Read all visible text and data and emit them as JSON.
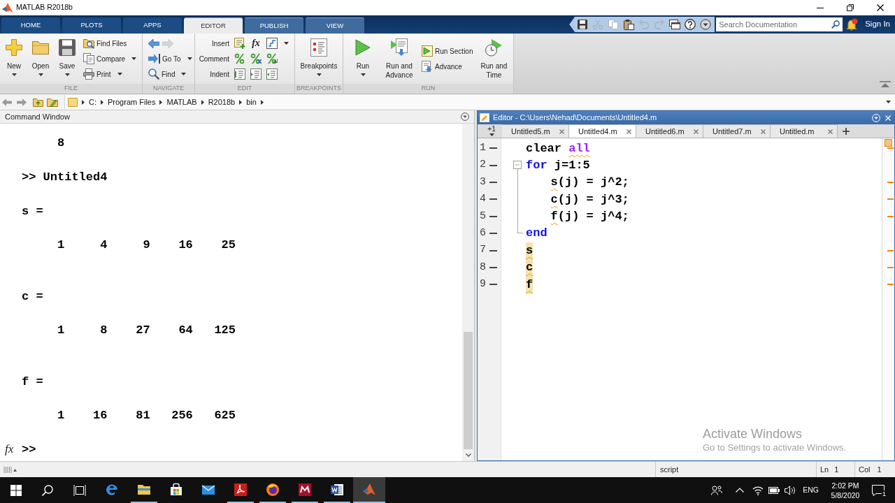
{
  "window": {
    "title": "MATLAB R2018b"
  },
  "ribbon_tabs": [
    {
      "label": "HOME",
      "kind": "global",
      "selected": false
    },
    {
      "label": "PLOTS",
      "kind": "global",
      "selected": false
    },
    {
      "label": "APPS",
      "kind": "global",
      "selected": false
    },
    {
      "label": "EDITOR",
      "kind": "contextual",
      "selected": true
    },
    {
      "label": "PUBLISH",
      "kind": "contextual",
      "selected": false
    },
    {
      "label": "VIEW",
      "kind": "contextual",
      "selected": false
    }
  ],
  "quick_access": [
    {
      "disabled": false
    },
    {
      "disabled": true
    },
    {
      "disabled": true
    },
    {
      "disabled": false
    },
    {
      "disabled": true
    },
    {
      "disabled": true
    },
    {
      "disabled": false
    },
    {
      "disabled": false
    },
    {
      "disabled": false
    }
  ],
  "search": {
    "placeholder": "Search Documentation"
  },
  "notifications": {
    "unread": true
  },
  "account": {
    "label": "Sign In"
  },
  "toolstrip": {
    "sections": [
      {
        "title": "FILE",
        "controls": [
          {
            "kind": "large",
            "label": "New",
            "menu": true
          },
          {
            "kind": "large",
            "label": "Open",
            "menu": true
          },
          {
            "kind": "large",
            "label": "Save",
            "menu": true
          },
          {
            "kind": "stack",
            "items": [
              {
                "kind": "button",
                "label": "Find Files",
                "menu": false
              },
              {
                "kind": "button",
                "label": "Compare",
                "menu": true
              },
              {
                "kind": "button",
                "label": "Print",
                "menu": true
              }
            ]
          }
        ]
      },
      {
        "title": "NAVIGATE",
        "controls": [
          {
            "kind": "stack",
            "items": [
              {
                "kind": "history",
                "buttons": [
                  {
                    "disabled": false
                  },
                  {
                    "disabled": true
                  }
                ]
              },
              {
                "kind": "button",
                "label": "Go To",
                "menu": true
              },
              {
                "kind": "button",
                "label": "Find",
                "menu": true
              }
            ]
          }
        ]
      },
      {
        "title": "EDIT",
        "controls": [
          {
            "kind": "rows",
            "rows": [
              {
                "label": "Insert",
                "symbol": "fx",
                "menu": true
              },
              {
                "label": "Comment",
                "menu": false
              },
              {
                "label": "Indent",
                "menu": false
              }
            ]
          }
        ]
      },
      {
        "title": "BREAKPOINTS",
        "controls": [
          {
            "kind": "large",
            "label": "Breakpoints",
            "menu": true
          }
        ]
      },
      {
        "title": "RUN",
        "controls": [
          {
            "kind": "large",
            "label": "Run",
            "menu": true
          },
          {
            "kind": "large",
            "label": "Run and Advance",
            "menu": false
          },
          {
            "kind": "stack",
            "items": [
              {
                "kind": "button",
                "label": "Run Section",
                "menu": false
              },
              {
                "kind": "button",
                "label": "Advance",
                "menu": false
              }
            ]
          },
          {
            "kind": "large",
            "label": "Run and Time",
            "menu": false
          }
        ]
      }
    ]
  },
  "current_folder": {
    "segments": [
      "C:",
      "Program Files",
      "MATLAB",
      "R2018b",
      "bin"
    ]
  },
  "command_window": {
    "title": "Command Window",
    "output": [
      {
        "kind": "values",
        "values": [
          "8"
        ]
      },
      {
        "kind": "command",
        "text": ">> Untitled4"
      },
      {
        "kind": "assignment",
        "text": "s ="
      },
      {
        "kind": "values",
        "values": [
          "1",
          "4",
          "9",
          "16",
          "25"
        ]
      },
      {
        "kind": "assignment",
        "text": "c ="
      },
      {
        "kind": "values",
        "values": [
          "1",
          "8",
          "27",
          "64",
          "125"
        ]
      },
      {
        "kind": "assignment",
        "text": "f ="
      },
      {
        "kind": "values",
        "values": [
          "1",
          "16",
          "81",
          "256",
          "625"
        ]
      }
    ],
    "function_browser": "fx",
    "prompt": ">>"
  },
  "editor": {
    "title": "Editor - C:\\Users\\Nehad\\Documents\\Untitled4.m",
    "tab_list": "+1",
    "tabs": [
      {
        "label": "Untitled5.m",
        "selected": false
      },
      {
        "label": "Untitled4.m",
        "selected": true
      },
      {
        "label": "Untitled6.m",
        "selected": false
      },
      {
        "label": "Untitled7.m",
        "selected": false
      },
      {
        "label": "Untitled.m",
        "selected": false
      }
    ],
    "lines": [
      {
        "number": "1",
        "executable": true,
        "tokens": [
          {
            "text": "clear ",
            "kind": "plain",
            "warning": false,
            "highlighted": false
          },
          {
            "text": "all",
            "kind": "string",
            "warning": true,
            "highlighted": false
          }
        ]
      },
      {
        "number": "2",
        "executable": true,
        "expanded": true,
        "tokens": [
          {
            "text": "for",
            "kind": "keyword",
            "warning": false,
            "highlighted": false
          },
          {
            "text": " j=1:5",
            "kind": "plain",
            "warning": false,
            "highlighted": false
          }
        ],
        "children": [
          {
            "number": "3",
            "executable": true,
            "tokens": [
              {
                "text": "s",
                "kind": "plain",
                "warning": true,
                "highlighted": false
              },
              {
                "text": "(j) = j^2;",
                "kind": "plain",
                "warning": false,
                "highlighted": false
              }
            ]
          },
          {
            "number": "4",
            "executable": true,
            "tokens": [
              {
                "text": "c",
                "kind": "plain",
                "warning": true,
                "highlighted": false
              },
              {
                "text": "(j) = j^3;",
                "kind": "plain",
                "warning": false,
                "highlighted": false
              }
            ]
          },
          {
            "number": "5",
            "executable": true,
            "tokens": [
              {
                "text": "f",
                "kind": "plain",
                "warning": true,
                "highlighted": false
              },
              {
                "text": "(j) = j^4;",
                "kind": "plain",
                "warning": false,
                "highlighted": false
              }
            ]
          }
        ]
      },
      {
        "number": "6",
        "executable": true,
        "tokens": [
          {
            "text": "end",
            "kind": "keyword",
            "warning": false,
            "highlighted": false
          }
        ]
      },
      {
        "number": "7",
        "executable": true,
        "tokens": [
          {
            "text": "s",
            "kind": "plain",
            "warning": true,
            "highlighted": true
          }
        ]
      },
      {
        "number": "8",
        "executable": true,
        "tokens": [
          {
            "text": "c",
            "kind": "plain",
            "warning": true,
            "highlighted": true
          }
        ]
      },
      {
        "number": "9",
        "executable": true,
        "tokens": [
          {
            "text": "f",
            "kind": "plain",
            "warning": true,
            "highlighted": true
          }
        ]
      }
    ]
  },
  "activation_notice": {
    "title": "Activate Windows",
    "message": "Go to Settings to activate Windows."
  },
  "status_bar": {
    "file_type": "script",
    "line": {
      "label": "Ln",
      "value": "1"
    },
    "column": {
      "label": "Col",
      "value": "1"
    }
  },
  "taskbar": {
    "apps": [
      {
        "open": false,
        "active": false
      },
      {
        "open": true,
        "active": false
      },
      {
        "open": false,
        "active": false
      },
      {
        "open": false,
        "active": false
      },
      {
        "open": true,
        "active": false
      },
      {
        "open": true,
        "active": false
      },
      {
        "open": true,
        "active": false
      },
      {
        "open": true,
        "active": false
      },
      {
        "open": true,
        "active": true
      }
    ],
    "tray": {
      "language": "ENG",
      "time": "2:02 PM",
      "date": "5/8/2020",
      "notification_count": "1"
    }
  }
}
